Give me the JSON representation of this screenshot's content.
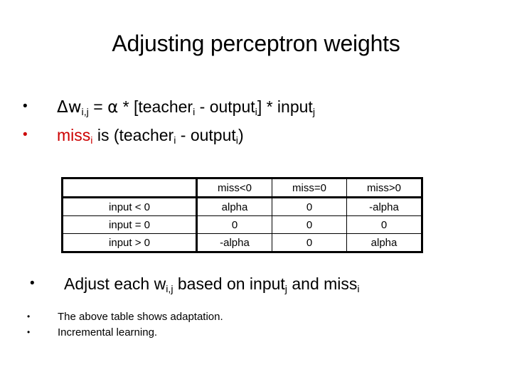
{
  "slide": {
    "title": "Adjusting perceptron weights",
    "background_color": "#ffffff",
    "text_color": "#000000",
    "accent_color": "#cc0000"
  },
  "bullets": {
    "b1": {
      "marker": "•",
      "marker_color": "#000000",
      "delta_w": "Δw",
      "delta_w_sub": "i,j",
      "eq": " = ",
      "alpha": "α",
      "mid": " * [teacher",
      "teacher_sub": "i",
      "minus": " - output",
      "output_sub": "i",
      "tail": "] * input",
      "input_sub": "j"
    },
    "b2": {
      "marker": "•",
      "marker_color": "#cc0000",
      "red_word": "miss",
      "red_sub": "i",
      "rest_a": " is (teacher",
      "teacher_sub": "i",
      "rest_b": " - output",
      "output_sub": "i",
      "rest_c": ")"
    },
    "b3": {
      "marker": "•",
      "marker_color": "#000000",
      "part_a": "Adjust each w",
      "w_sub": "i,j",
      "part_b": " based on input",
      "input_sub": "j",
      "part_c": " and miss",
      "miss_sub": "i"
    },
    "b4": {
      "marker": "•",
      "marker_color": "#000000",
      "text": "The above table shows adaptation."
    },
    "b5": {
      "marker": "•",
      "marker_color": "#000000",
      "text": " Incremental learning."
    }
  },
  "table": {
    "headers": [
      "",
      "miss<0",
      "miss=0",
      "miss>0"
    ],
    "rows": [
      {
        "label": "input < 0",
        "cells": [
          "alpha",
          "0",
          "-alpha"
        ]
      },
      {
        "label": "input = 0",
        "cells": [
          "0",
          "0",
          "0"
        ]
      },
      {
        "label": "input > 0",
        "cells": [
          "-alpha",
          "0",
          "alpha"
        ]
      }
    ]
  }
}
